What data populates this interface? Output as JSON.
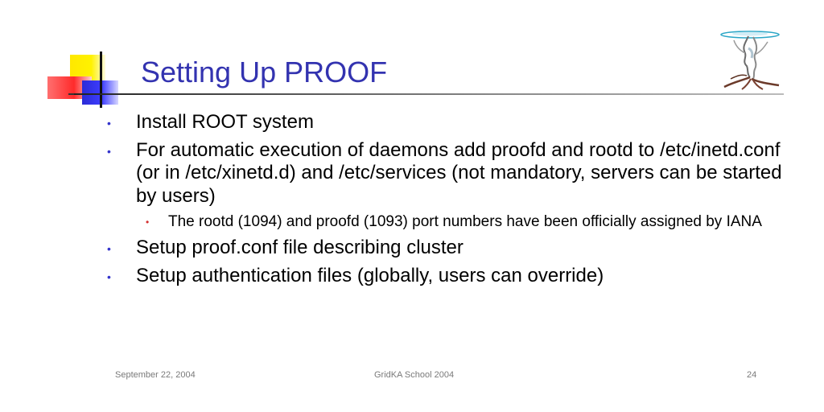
{
  "slide": {
    "title": "Setting Up PROOF",
    "bullets": [
      "Install ROOT system",
      "For automatic execution of daemons add proofd and rootd to /etc/inetd.conf (or in /etc/xinetd.d) and /etc/services (not mandatory, servers can be started by users)",
      "Setup proof.conf file describing cluster",
      "Setup authentication files (globally, users can override)"
    ],
    "sub_bullets": [
      "The rootd (1094) and proofd (1093) port numbers have been officially assigned by IANA"
    ],
    "bullet_glyph": "•",
    "bullet_color": "#3333cc",
    "sub_bullet_color": "#d43030",
    "title_color": "#3333b0"
  },
  "footer": {
    "date": "September 22, 2004",
    "event": "GridKA School 2004",
    "page": "24"
  },
  "icons": {
    "deco": "color-squares-deco-icon",
    "logo": "tree-globe-logo-icon"
  }
}
